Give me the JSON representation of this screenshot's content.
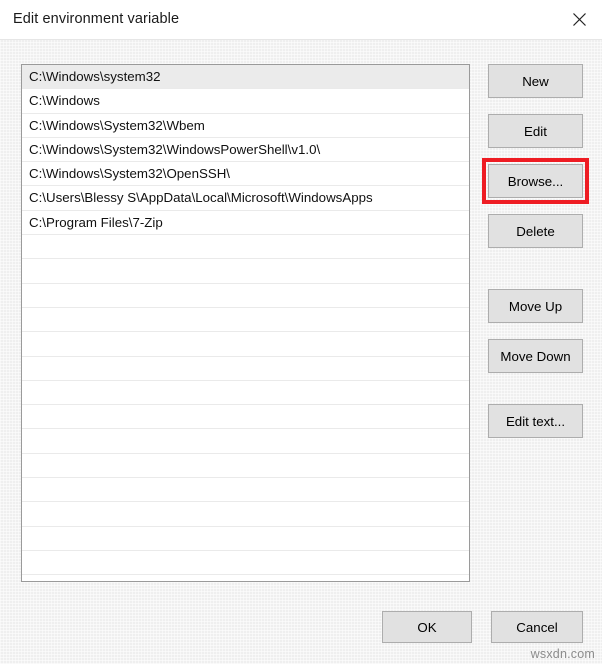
{
  "window": {
    "title": "Edit environment variable",
    "close_icon": "close-icon"
  },
  "path_list": {
    "selected_index": 0,
    "entries": [
      "C:\\Windows\\system32",
      "C:\\Windows",
      "C:\\Windows\\System32\\Wbem",
      "C:\\Windows\\System32\\WindowsPowerShell\\v1.0\\",
      "C:\\Windows\\System32\\OpenSSH\\",
      "C:\\Users\\Blessy S\\AppData\\Local\\Microsoft\\WindowsApps",
      "C:\\Program Files\\7-Zip"
    ],
    "empty_row_count": 14
  },
  "side_buttons": {
    "new": "New",
    "edit": "Edit",
    "browse": "Browse...",
    "delete": "Delete",
    "move_up": "Move Up",
    "move_down": "Move Down",
    "edit_text": "Edit text..."
  },
  "footer_buttons": {
    "ok": "OK",
    "cancel": "Cancel"
  },
  "annotation": {
    "target": "browse",
    "color": "#ee1c23"
  },
  "watermark": {
    "text": "wsxdn.com"
  }
}
